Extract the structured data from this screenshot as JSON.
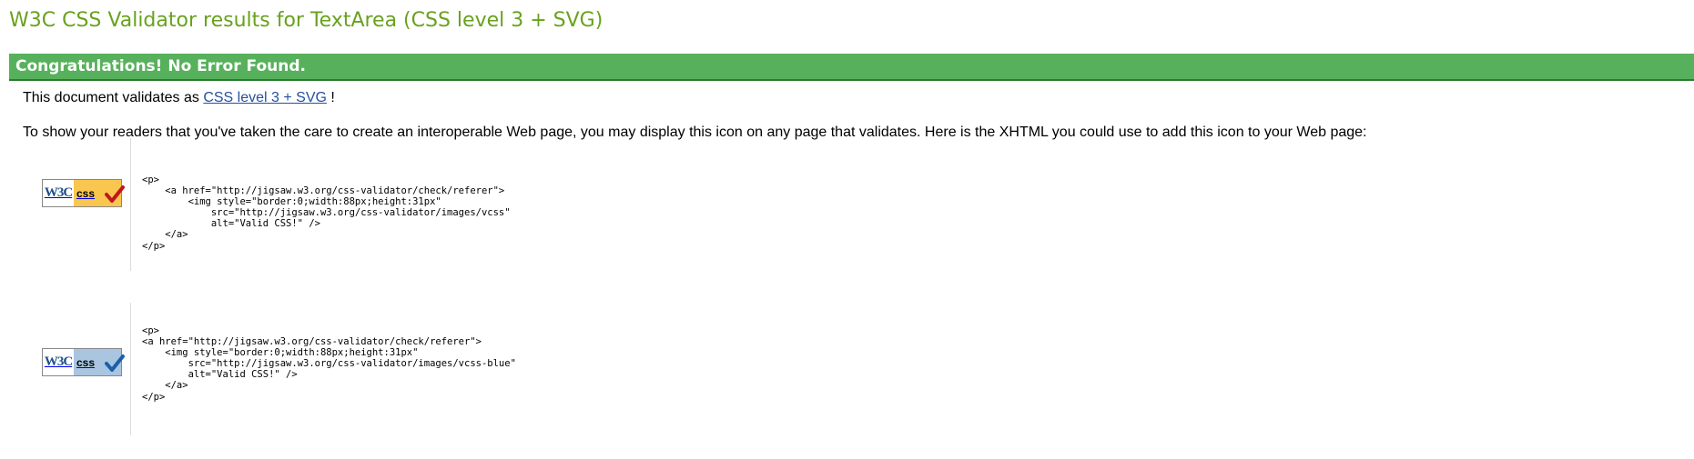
{
  "page": {
    "title": "W3C CSS Validator results for TextArea (CSS level 3 + SVG)"
  },
  "banner": {
    "text": "Congratulations! No Error Found."
  },
  "validation": {
    "prefix": "This document validates as",
    "link_text": "CSS level 3 + SVG",
    "suffix": "!"
  },
  "instructions": "To show your readers that you've taken the care to create an interoperable Web page, you may display this icon on any page that validates. Here is the XHTML you could use to add this icon to your Web page:",
  "badges": [
    {
      "icon": "w3c-css-valid-badge-gold",
      "w3c_text": "W3C",
      "css_text": "css",
      "bg_color": "#f9c74f",
      "check_color": "#c0171d",
      "code": "<p>\n    <a href=\"http://jigsaw.w3.org/css-validator/check/referer\">\n        <img style=\"border:0;width:88px;height:31px\"\n            src=\"http://jigsaw.w3.org/css-validator/images/vcss\"\n            alt=\"Valid CSS!\" />\n    </a>\n</p>"
    },
    {
      "icon": "w3c-css-valid-badge-blue",
      "w3c_text": "W3C",
      "css_text": "css",
      "bg_color": "#a9c5e0",
      "check_color": "#1d5fa8",
      "code": "<p>\n<a href=\"http://jigsaw.w3.org/css-validator/check/referer\">\n    <img style=\"border:0;width:88px;height:31px\"\n        src=\"http://jigsaw.w3.org/css-validator/images/vcss-blue\"\n        alt=\"Valid CSS!\" />\n    </a>\n</p>"
    }
  ]
}
